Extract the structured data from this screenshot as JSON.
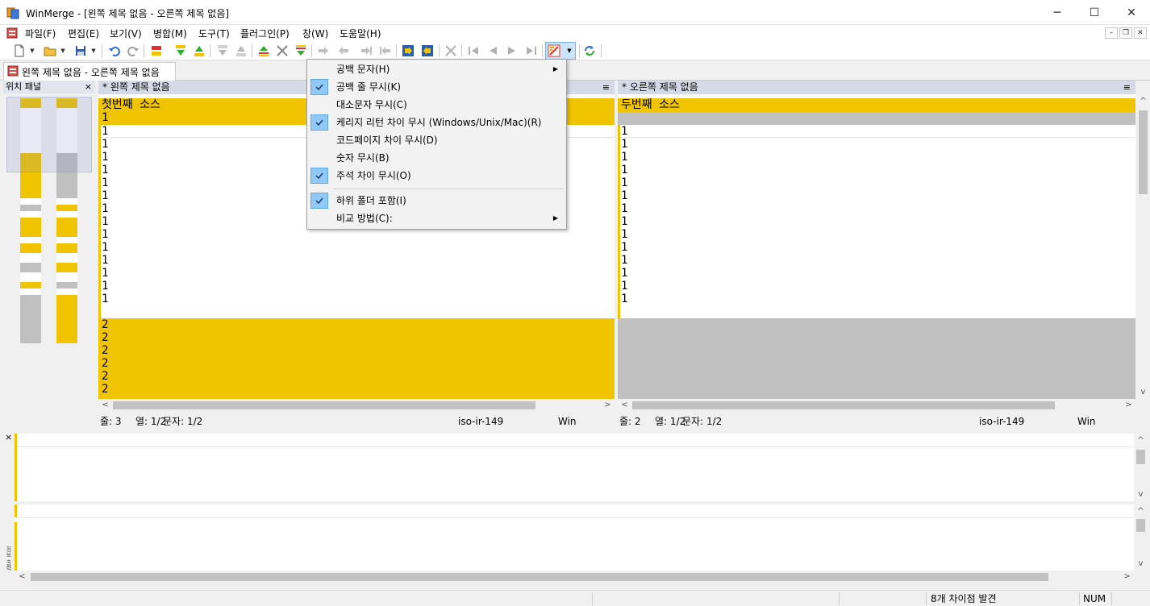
{
  "window": {
    "title": "WinMerge - [왼쪽 제목 없음 - 오른쪽 제목 없음]",
    "minimize": "─",
    "maximize": "☐",
    "close": "✕"
  },
  "menu": {
    "items": [
      "파일(F)",
      "편집(E)",
      "보기(V)",
      "병합(M)",
      "도구(T)",
      "플러그인(P)",
      "창(W)",
      "도움말(H)"
    ],
    "mdi": {
      "minimize": "–",
      "restore": "❐",
      "close": "✕"
    }
  },
  "tab": {
    "label": "왼쪽 제목 없음 - 오른쪽 제목 없음"
  },
  "location_panel": {
    "title": "위치 패널",
    "close": "×"
  },
  "left_pane": {
    "header": "* 왼쪽 제목 없음",
    "menu_glyph": "≡",
    "first_line": "첫번째 소스",
    "ones": "1",
    "twos": "2",
    "status": {
      "line": "줄: 3",
      "col": "열: 1/2",
      "char": "문자: 1/2",
      "encoding": "iso-ir-149",
      "eol": "Win"
    }
  },
  "right_pane": {
    "header": "* 오른쪽 제목 없음",
    "menu_glyph": "≡",
    "first_line": "두번째 소스",
    "ones": "1",
    "status": {
      "line": "줄: 2",
      "col": "열: 1/2",
      "char": "문자: 1/2",
      "encoding": "iso-ir-149",
      "eol": "Win"
    }
  },
  "diff_pane": {
    "close": "×",
    "side_label": "정보 출력"
  },
  "status_bar": {
    "differences": "8개 차이점 발견",
    "num": "NUM"
  },
  "context_menu": {
    "items": [
      {
        "label": "공백 문자(H)",
        "checked": false,
        "submenu": true
      },
      {
        "label": "공백 줄 무시(K)",
        "checked": true,
        "submenu": false
      },
      {
        "label": "대소문자 무시(C)",
        "checked": false,
        "submenu": false
      },
      {
        "label": "케리지 리턴 차이 무시 (Windows/Unix/Mac)(R)",
        "checked": true,
        "submenu": false
      },
      {
        "label": "코드페이지 차이 무시(D)",
        "checked": false,
        "submenu": false
      },
      {
        "label": "숫자 무시(B)",
        "checked": false,
        "submenu": false
      },
      {
        "label": "주석 차이 무시(O)",
        "checked": true,
        "submenu": false
      },
      {
        "label": "하위 폴더 포함(I)",
        "checked": true,
        "submenu": false
      },
      {
        "label": "비교 방법(C):",
        "checked": false,
        "submenu": true
      }
    ]
  },
  "colors": {
    "diff_yellow": "#f0c400",
    "diff_gray": "#c0c0c0",
    "header_blue": "#d4dbe6",
    "check_blue": "#90c8f6"
  },
  "icons": {
    "scroll_left": "<",
    "scroll_right": ">",
    "scroll_up": "^",
    "scroll_down": "v",
    "submenu_arrow": "▶",
    "dropdown": "▼",
    "check": "✓"
  }
}
